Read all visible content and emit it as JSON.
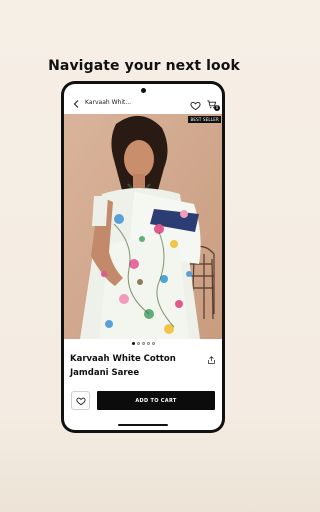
{
  "promo": {
    "headline": "Navigate your next look"
  },
  "header": {
    "title": "Karvaah Whit...",
    "cart_count": "0"
  },
  "product": {
    "badge": "BEST SELLER",
    "name": "Karvaah White Cotton Jamdani Saree",
    "image_alt": "Model wearing white floral cotton jamdani saree",
    "carousel": {
      "total": 5,
      "active": 1
    }
  },
  "actions": {
    "add_to_cart_label": "ADD TO CART"
  },
  "icons": {
    "back": "chevron-left-icon",
    "wishlist": "heart-icon",
    "cart": "shopping-bag-icon",
    "share": "share-icon"
  },
  "colors": {
    "button": "#0c0c0c",
    "background": "#f6efe6",
    "image_backdrop": "#d8b197"
  }
}
